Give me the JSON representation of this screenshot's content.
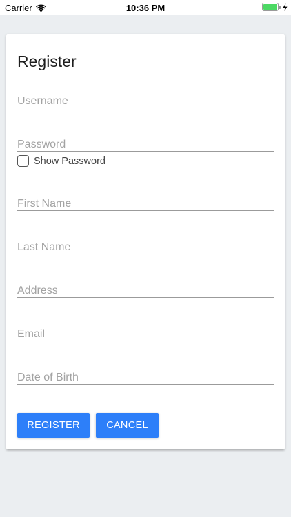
{
  "status_bar": {
    "carrier": "Carrier",
    "time": "10:36 PM",
    "battery_level": 1.0,
    "icons": [
      "wifi-icon",
      "battery-icon",
      "charging-icon"
    ]
  },
  "form": {
    "title": "Register",
    "fields": {
      "username": {
        "placeholder": "Username",
        "value": ""
      },
      "password": {
        "placeholder": "Password",
        "value": ""
      },
      "first_name": {
        "placeholder": "First Name",
        "value": ""
      },
      "last_name": {
        "placeholder": "Last Name",
        "value": ""
      },
      "address": {
        "placeholder": "Address",
        "value": ""
      },
      "email": {
        "placeholder": "Email",
        "value": ""
      },
      "dob": {
        "placeholder": "Date of Birth",
        "value": ""
      }
    },
    "show_password": {
      "label": "Show Password",
      "checked": false
    },
    "buttons": {
      "register": "REGISTER",
      "cancel": "CANCEL"
    }
  },
  "colors": {
    "accent": "#2d7ff9",
    "background": "#ebeef1",
    "battery": "#4cd964"
  }
}
